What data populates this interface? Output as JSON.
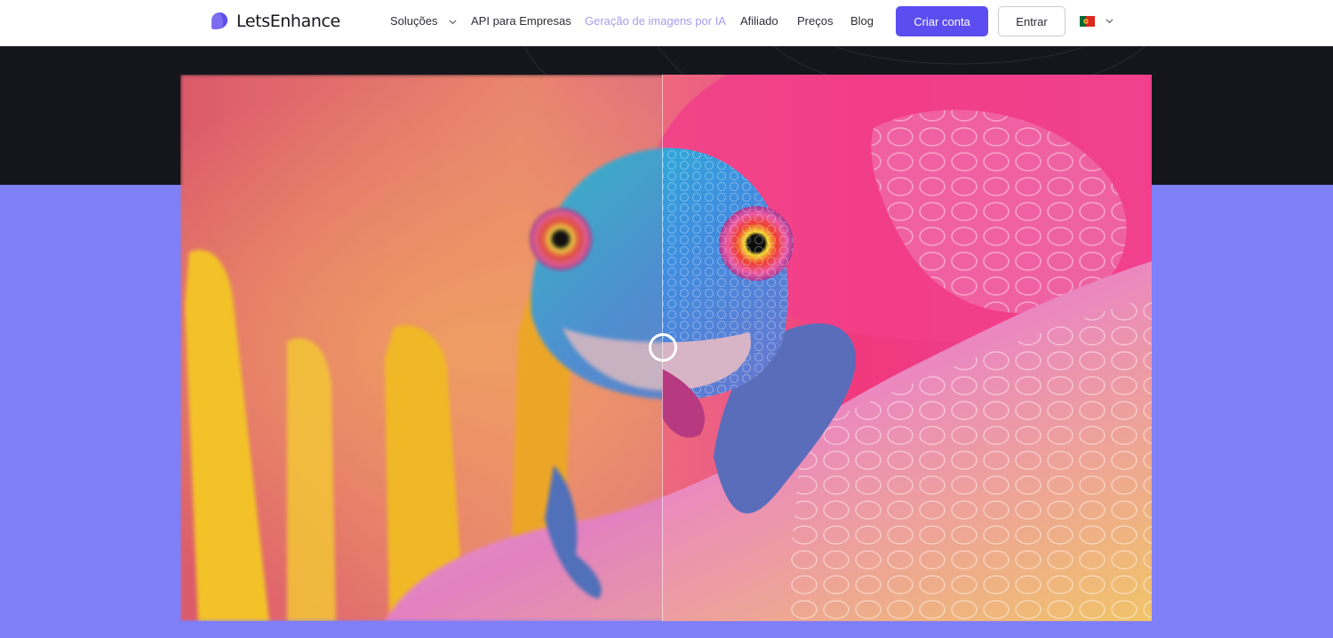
{
  "brand": {
    "name": "LetsEnhance",
    "color": "#7c6cf0"
  },
  "nav": {
    "solutions_label": "Soluções",
    "api_label": "API para Empresas",
    "ai_generation_label": "Geração de imagens por IA",
    "affiliate_label": "Afiliado",
    "pricing_label": "Preços",
    "blog_label": "Blog",
    "signup_label": "Criar conta",
    "login_label": "Entrar",
    "language_icon": "portugal-flag-icon"
  },
  "colors": {
    "accent": "#5b4df0",
    "active_nav": "#a79bf0",
    "hero_dark": "#15161c",
    "page_background": "#7f7ff7"
  },
  "comparison": {
    "slider_position": 0.5,
    "before_icon": "blurred-chameleon-image",
    "after_icon": "sharp-chameleon-image"
  }
}
